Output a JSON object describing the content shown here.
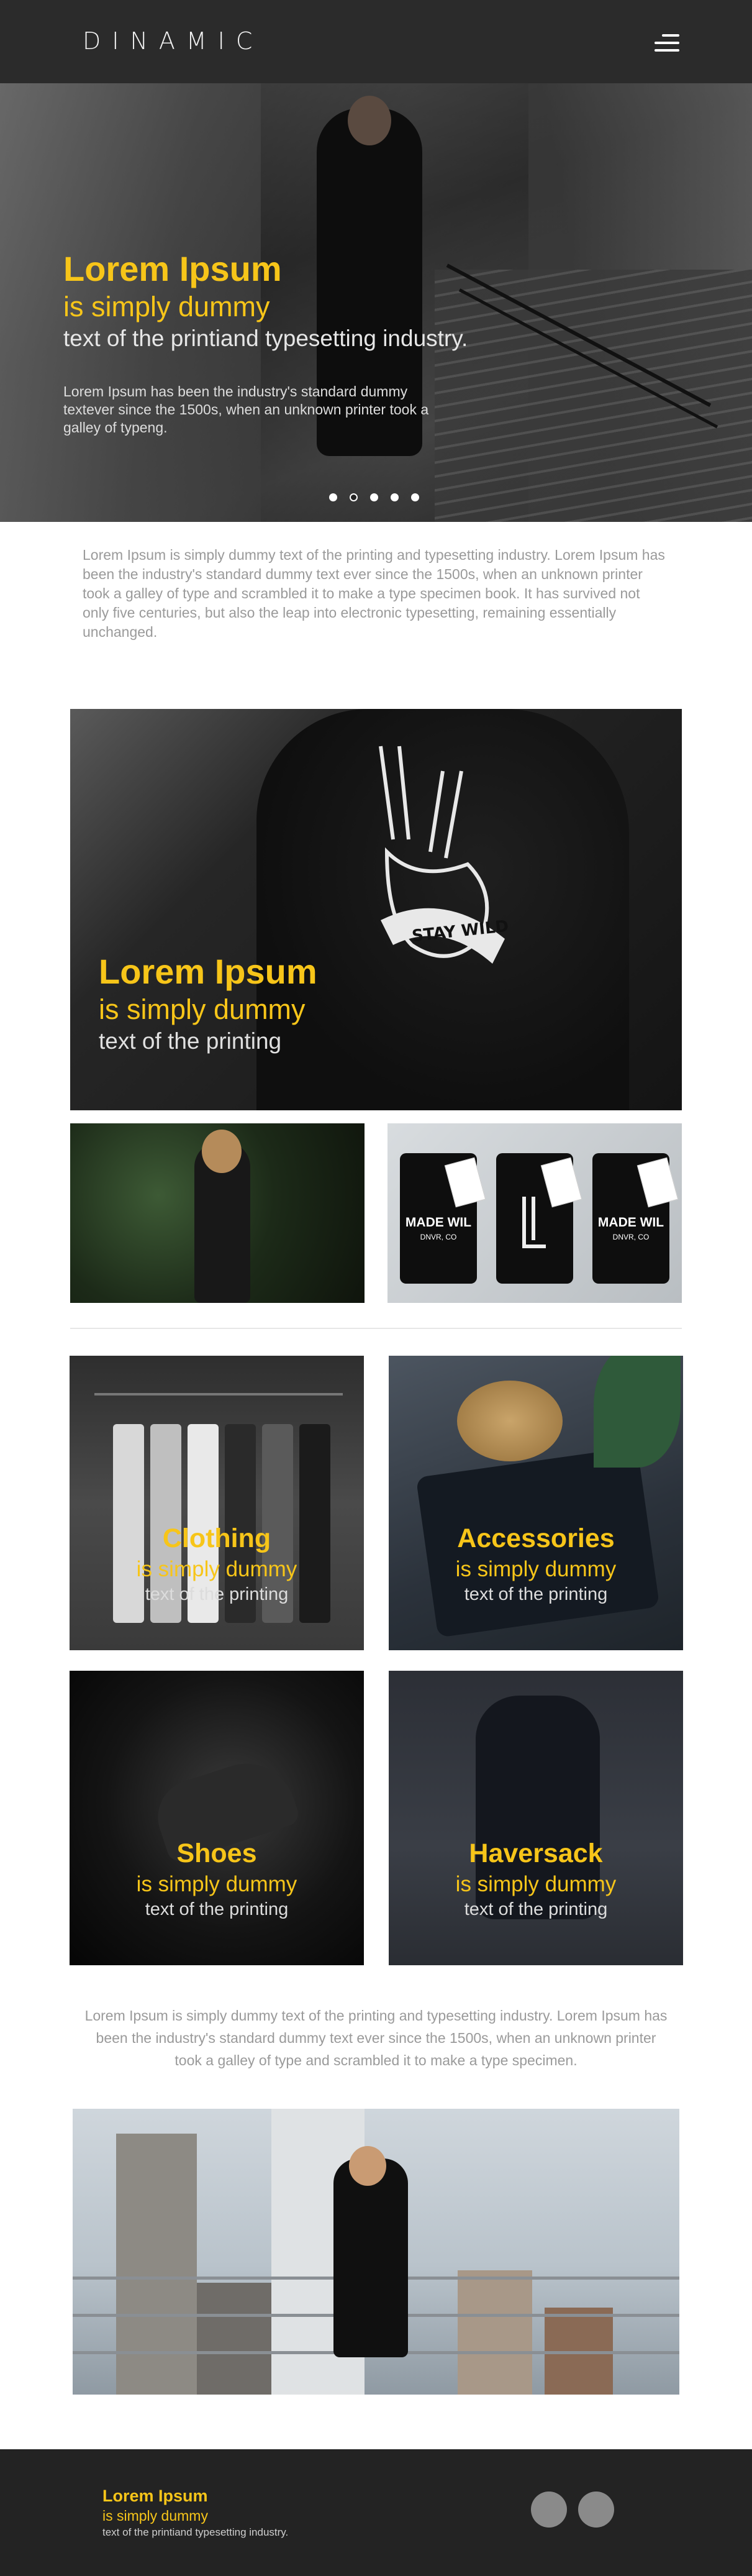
{
  "header": {
    "logo": "DINAMIC",
    "menu_icon": "hamburger-menu-icon"
  },
  "hero": {
    "title": "Lorem Ipsum",
    "subtitle1": "is simply dummy",
    "subtitle2": "text of the printiand typesetting industry.",
    "paragraph": "Lorem Ipsum has been the industry's standard dummy textever since the 1500s, when an unknown printer took a galley of typeng.",
    "slides": 5,
    "active_slide": 2
  },
  "intro": {
    "text": "Lorem Ipsum is simply dummy text of the printing and typesetting industry. Lorem Ipsum has been the industry's standard dummy text ever since the 1500s, when an unknown printer took a galley of type and scrambled it to make a type specimen book. It has survived not only five centuries, but also the leap into electronic typesetting, remaining essentially unchanged."
  },
  "feature": {
    "title": "Lorem Ipsum",
    "subtitle1": "is simply dummy",
    "subtitle2": "text of the printing",
    "shirt_print": "STAY WILD"
  },
  "thumbnails": {
    "tee_label": "MADE WIL",
    "tee_sublabel": "DNVR, CO"
  },
  "categories": [
    {
      "title": "Clothing",
      "subtitle1": "is simply dummy",
      "subtitle2": "text of the printing"
    },
    {
      "title": "Accessories",
      "subtitle1": "is simply dummy",
      "subtitle2": "text of the printing"
    },
    {
      "title": "Shoes",
      "subtitle1": "is simply dummy",
      "subtitle2": "text of the printing"
    },
    {
      "title": "Haversack",
      "subtitle1": "is simply dummy",
      "subtitle2": "text of the printing"
    }
  ],
  "intro2": {
    "text": "Lorem Ipsum is simply dummy text of the printing and typesetting industry. Lorem Ipsum has been the industry's standard dummy text ever since the 1500s, when an unknown printer took a galley of type and scrambled it to make a type specimen."
  },
  "footer": {
    "title": "Lorem Ipsum",
    "subtitle1": "is simply dummy",
    "subtitle2": "text of the printiand typesetting industry."
  },
  "colors": {
    "accent": "#f7c519",
    "header_bg": "#2b2b2b",
    "footer_bg": "#232323",
    "body_text": "#9a9a9a"
  }
}
